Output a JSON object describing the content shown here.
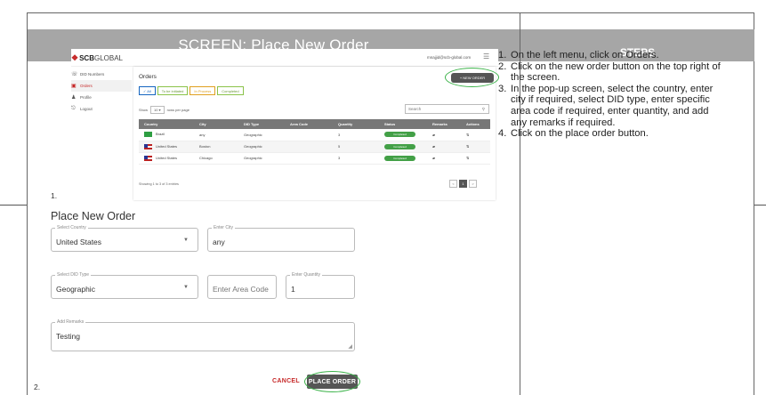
{
  "header": {
    "screen_title": "SCREEN: Place New Order",
    "steps_title": "STEPS"
  },
  "steps": [
    {
      "num": "1.",
      "text": "On the left menu, click on Orders."
    },
    {
      "num": "2.",
      "text": "Click on the new order button on the top right of the screen."
    },
    {
      "num": "3.",
      "text": "In the pop-up screen, select the country, enter city if required, select DID type, enter specific area code if required, enter quantity, and add any remarks if required."
    },
    {
      "num": "4.",
      "text": "Click on the place order button."
    }
  ],
  "shot1": {
    "logo_bold": "SCB",
    "logo_light": "GLOBAL",
    "user_email": "mnajjid@scb-global.com",
    "menu": [
      {
        "label": "DID Numbers",
        "icon": "phone-icon"
      },
      {
        "label": "Orders",
        "icon": "bag-icon"
      },
      {
        "label": "Profile",
        "icon": "person-icon"
      },
      {
        "label": "Logout",
        "icon": "logout-icon"
      }
    ],
    "orders_title": "Orders",
    "new_order_label": "+ NEW ORDER",
    "filters": [
      "✓ All",
      "To be initiated",
      "In Process",
      "Completed"
    ],
    "show_label": "Show",
    "show_value": "10",
    "per_page_label": "rows per page",
    "search_placeholder": "Search",
    "columns": [
      "Country",
      "City",
      "DID Type",
      "Area Code",
      "Quantity",
      "Status",
      "Remarks",
      "Actions"
    ],
    "rows": [
      {
        "country": "Brazil",
        "city": "any",
        "did_type": "Geographic",
        "area_code": "",
        "quantity": "3",
        "status": "Completed"
      },
      {
        "country": "United States",
        "city": "Boston",
        "did_type": "Geographic",
        "area_code": "",
        "quantity": "5",
        "status": "Completed"
      },
      {
        "country": "United States",
        "city": "Chicago",
        "did_type": "Geographic",
        "area_code": "",
        "quantity": "3",
        "status": "Completed"
      }
    ],
    "showing_text": "Showing 1 to 3 of 3 entries",
    "pager": [
      "<",
      "1",
      ">"
    ]
  },
  "labels": {
    "one": "1.",
    "two": "2."
  },
  "form": {
    "title": "Place New Order",
    "country_label": "Select Country",
    "country_value": "United States",
    "city_label": "Enter City",
    "city_value": "any",
    "did_type_label": "Select DID Type",
    "did_type_value": "Geographic",
    "area_code_placeholder": "Enter Area Code",
    "quantity_label": "Enter Quantity",
    "quantity_value": "1",
    "remarks_label": "Add Remarks",
    "remarks_value": "Testing",
    "cancel_label": "CANCEL",
    "place_order_label": "PLACE ORDER"
  },
  "colors": {
    "header_bg": "#a6a6a6",
    "accent_green": "#3cb34a",
    "cancel_red": "#c62828",
    "button_dark": "#555555"
  }
}
